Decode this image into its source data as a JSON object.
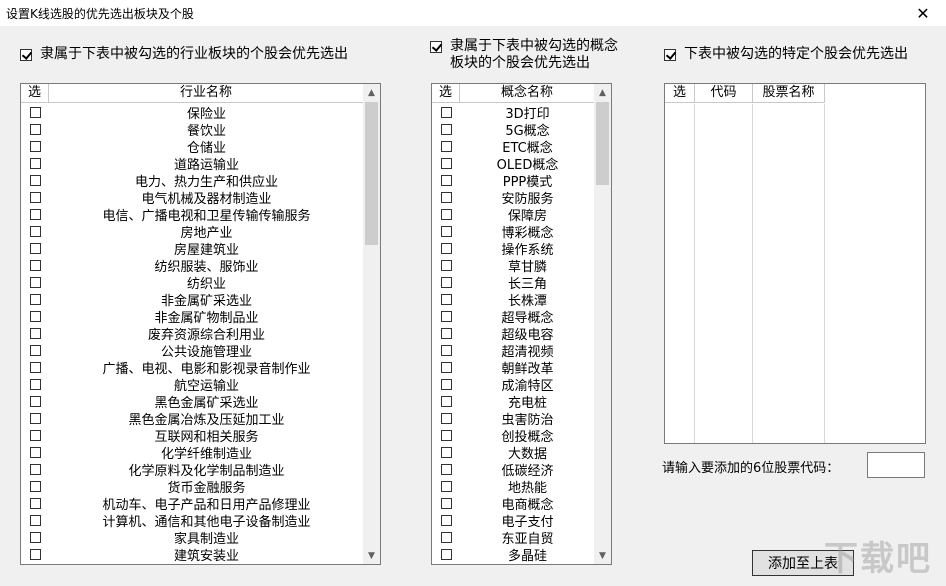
{
  "window": {
    "title": "设置K线选股的优先选出板块及个股",
    "close_glyph": "✕"
  },
  "options": {
    "industry": {
      "label": "隶属于下表中被勾选的行业板块的个股会优先选出",
      "checked": true
    },
    "concept": {
      "label": "隶属于下表中被勾选的概念板块的个股会优先选出",
      "checked": true
    },
    "specific": {
      "label": "下表中被勾选的特定个股会优先选出",
      "checked": true
    }
  },
  "industry_list": {
    "headers": {
      "select": "选",
      "name": "行业名称"
    },
    "items": [
      "保险业",
      "餐饮业",
      "仓储业",
      "道路运输业",
      "电力、热力生产和供应业",
      "电气机械及器材制造业",
      "电信、广播电视和卫星传输传输服务",
      "房地产业",
      "房屋建筑业",
      "纺织服装、服饰业",
      "纺织业",
      "非金属矿采选业",
      "非金属矿物制品业",
      "废弃资源综合利用业",
      "公共设施管理业",
      "广播、电视、电影和影视录音制作业",
      "航空运输业",
      "黑色金属矿采选业",
      "黑色金属冶炼及压延加工业",
      "互联网和相关服务",
      "化学纤维制造业",
      "化学原料及化学制品制造业",
      "货币金融服务",
      "机动车、电子产品和日用产品修理业",
      "计算机、通信和其他电子设备制造业",
      "家具制造业",
      "建筑安装业"
    ]
  },
  "concept_list": {
    "headers": {
      "select": "选",
      "name": "概念名称"
    },
    "items": [
      "3D打印",
      "5G概念",
      "ETC概念",
      "OLED概念",
      "PPP模式",
      "安防服务",
      "保障房",
      "博彩概念",
      "操作系统",
      "草甘膦",
      "长三角",
      "长株潭",
      "超导概念",
      "超级电容",
      "超清视频",
      "朝鲜改革",
      "成渝特区",
      "充电桩",
      "虫害防治",
      "创投概念",
      "大数据",
      "低碳经济",
      "地热能",
      "电商概念",
      "电子支付",
      "东亚自贸",
      "多晶硅"
    ]
  },
  "stock_list": {
    "headers": {
      "select": "选",
      "code": "代码",
      "name": "股票名称"
    },
    "items": []
  },
  "input": {
    "label": "请输入要添加的6位股票代码：",
    "value": "",
    "placeholder": ""
  },
  "add_button": {
    "label": "添加至上表"
  },
  "scroll": {
    "up": "▲",
    "down": "▼"
  },
  "watermark": {
    "text": "下载吧"
  }
}
